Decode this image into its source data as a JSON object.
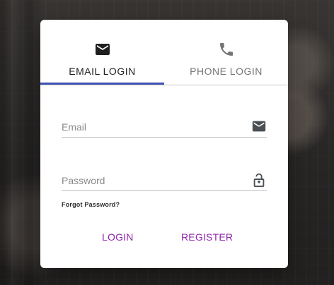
{
  "tabs": {
    "email": {
      "label": "EMAIL LOGIN",
      "icon": "email-icon"
    },
    "phone": {
      "label": "PHONE LOGIN",
      "icon": "phone-icon"
    },
    "active": "email",
    "indicator_color": "#3f51b5"
  },
  "form": {
    "email": {
      "placeholder": "Email",
      "value": "",
      "icon": "mail-icon"
    },
    "password": {
      "placeholder": "Password",
      "value": "",
      "icon": "lock-icon"
    },
    "forgot_password": "Forgot Password?"
  },
  "actions": {
    "login": "LOGIN",
    "register": "REGISTER",
    "accent_color": "#8e24aa"
  }
}
